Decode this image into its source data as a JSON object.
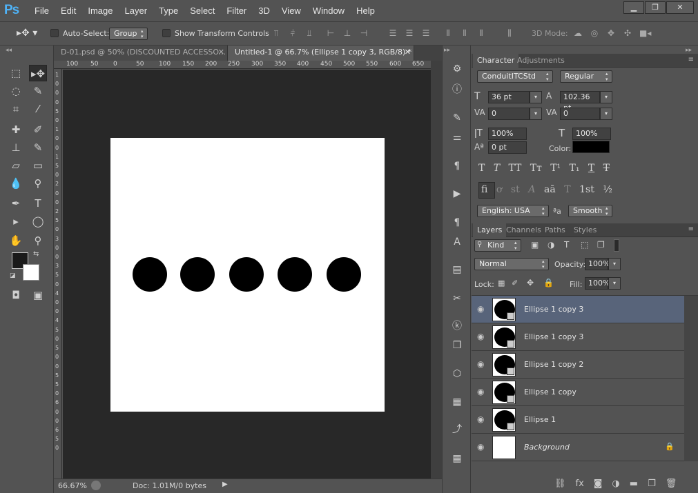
{
  "app": {
    "logo": "Ps"
  },
  "menu": [
    "File",
    "Edit",
    "Image",
    "Layer",
    "Type",
    "Select",
    "Filter",
    "3D",
    "View",
    "Window",
    "Help"
  ],
  "window_controls": [
    "minimize-icon",
    "maximize-icon",
    "close-icon"
  ],
  "options_bar": {
    "auto_select_label": "Auto-Select:",
    "auto_select_value": "Group",
    "show_transform_label": "Show Transform Controls",
    "mode_3d_label": "3D Mode:"
  },
  "documents": {
    "tabs": [
      {
        "label": "D-01.psd @ 50% (DISCOUNTED ACCESSO...",
        "active": false
      },
      {
        "label": "Untitled-1 @ 66.7% (Ellipse 1 copy 3, RGB/8) *",
        "active": true
      }
    ]
  },
  "ruler": {
    "top_ticks": [
      "100",
      "50",
      "0",
      "50",
      "100",
      "150",
      "200",
      "250",
      "300",
      "350",
      "400",
      "450",
      "500",
      "550",
      "600",
      "650"
    ],
    "left_ticks": [
      "1",
      "0",
      "0",
      "0",
      "5",
      "0",
      "1",
      "0",
      "0",
      "1",
      "5",
      "0",
      "2",
      "0",
      "0",
      "2",
      "5",
      "0",
      "3",
      "0",
      "0",
      "3",
      "5",
      "0",
      "4",
      "0",
      "0",
      "4",
      "5",
      "0",
      "5",
      "0",
      "0",
      "5",
      "5",
      "0",
      "6",
      "0",
      "0",
      "6",
      "5",
      "0"
    ]
  },
  "canvas": {
    "circle_count": 5
  },
  "status": {
    "zoom": "66.67%",
    "doc": "Doc: 1.01M/0 bytes"
  },
  "character_panel": {
    "tabs": [
      "Character",
      "Adjustments"
    ],
    "font_family": "ConduitITCStd",
    "font_style": "Regular",
    "size": "36 pt",
    "leading": "102.36 pt",
    "kerning": "0",
    "tracking": "0",
    "vscale": "100%",
    "hscale": "100%",
    "baseline": "0 pt",
    "color_label": "Color:",
    "color_value": "#000000",
    "style_buttons": [
      "T",
      "T",
      "TT",
      "Tт",
      "T¹",
      "T₁",
      "T",
      "T"
    ],
    "opentype_buttons": [
      "fi",
      "ơ",
      "st",
      "A",
      "aā",
      "T",
      "1st",
      "½"
    ],
    "language": "English: USA",
    "aa_label": "ªa",
    "antialias": "Smooth"
  },
  "layers_panel": {
    "tabs": [
      "Layers",
      "Channels",
      "Paths",
      "Styles"
    ],
    "filter_kind": "Kind",
    "blend_mode": "Normal",
    "opacity_label": "Opacity:",
    "opacity": "100%",
    "lock_label": "Lock:",
    "fill_label": "Fill:",
    "fill": "100%",
    "layers": [
      {
        "name": "Ellipse 1 copy 3",
        "selected": true
      },
      {
        "name": "Ellipse 1 copy 3",
        "selected": false
      },
      {
        "name": "Ellipse 1 copy 2",
        "selected": false
      },
      {
        "name": "Ellipse 1 copy",
        "selected": false
      },
      {
        "name": "Ellipse 1",
        "selected": false
      },
      {
        "name": "Background",
        "selected": false
      }
    ]
  },
  "colors": {
    "accent": "#4fb3f8",
    "selected_layer": "#58647a",
    "foreground": "#1a1a1a",
    "background": "#ffffff"
  }
}
